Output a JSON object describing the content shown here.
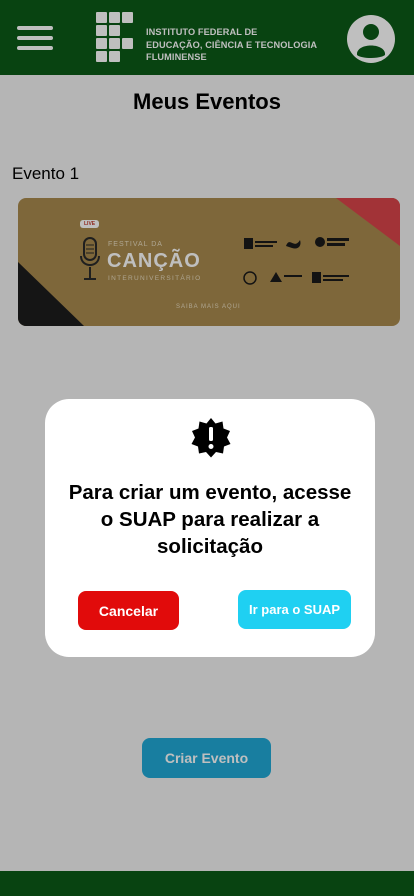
{
  "header": {
    "logo_line1": "INSTITUTO FEDERAL DE",
    "logo_line2": "EDUCAÇÃO, CIÊNCIA E TECNOLOGIA",
    "logo_line3": "FLUMINENSE",
    "menu_icon": "hamburger-menu-icon",
    "account_icon": "account-circle-icon"
  },
  "main": {
    "title": "Meus Eventos",
    "events": [
      {
        "label": "Evento 1",
        "banner": {
          "live": "LIVE",
          "festival": "FESTIVAL DA",
          "name": "CANÇÃO",
          "subtitle": "INTERUNIVERSITÁRIO",
          "cta": "SAIBA MAIS AQUI"
        }
      }
    ],
    "create_button": "Criar Evento"
  },
  "modal": {
    "icon": "alert-badge-icon",
    "message": "Para criar um evento, acesse o SUAP para realizar a solicitação",
    "cancel_label": "Cancelar",
    "confirm_label": "Ir para o SUAP"
  },
  "colors": {
    "header_green": "#0b5a17",
    "cancel_red": "#e10b0b",
    "suap_cyan": "#1fd0f2",
    "create_blue": "#20a9d6"
  }
}
